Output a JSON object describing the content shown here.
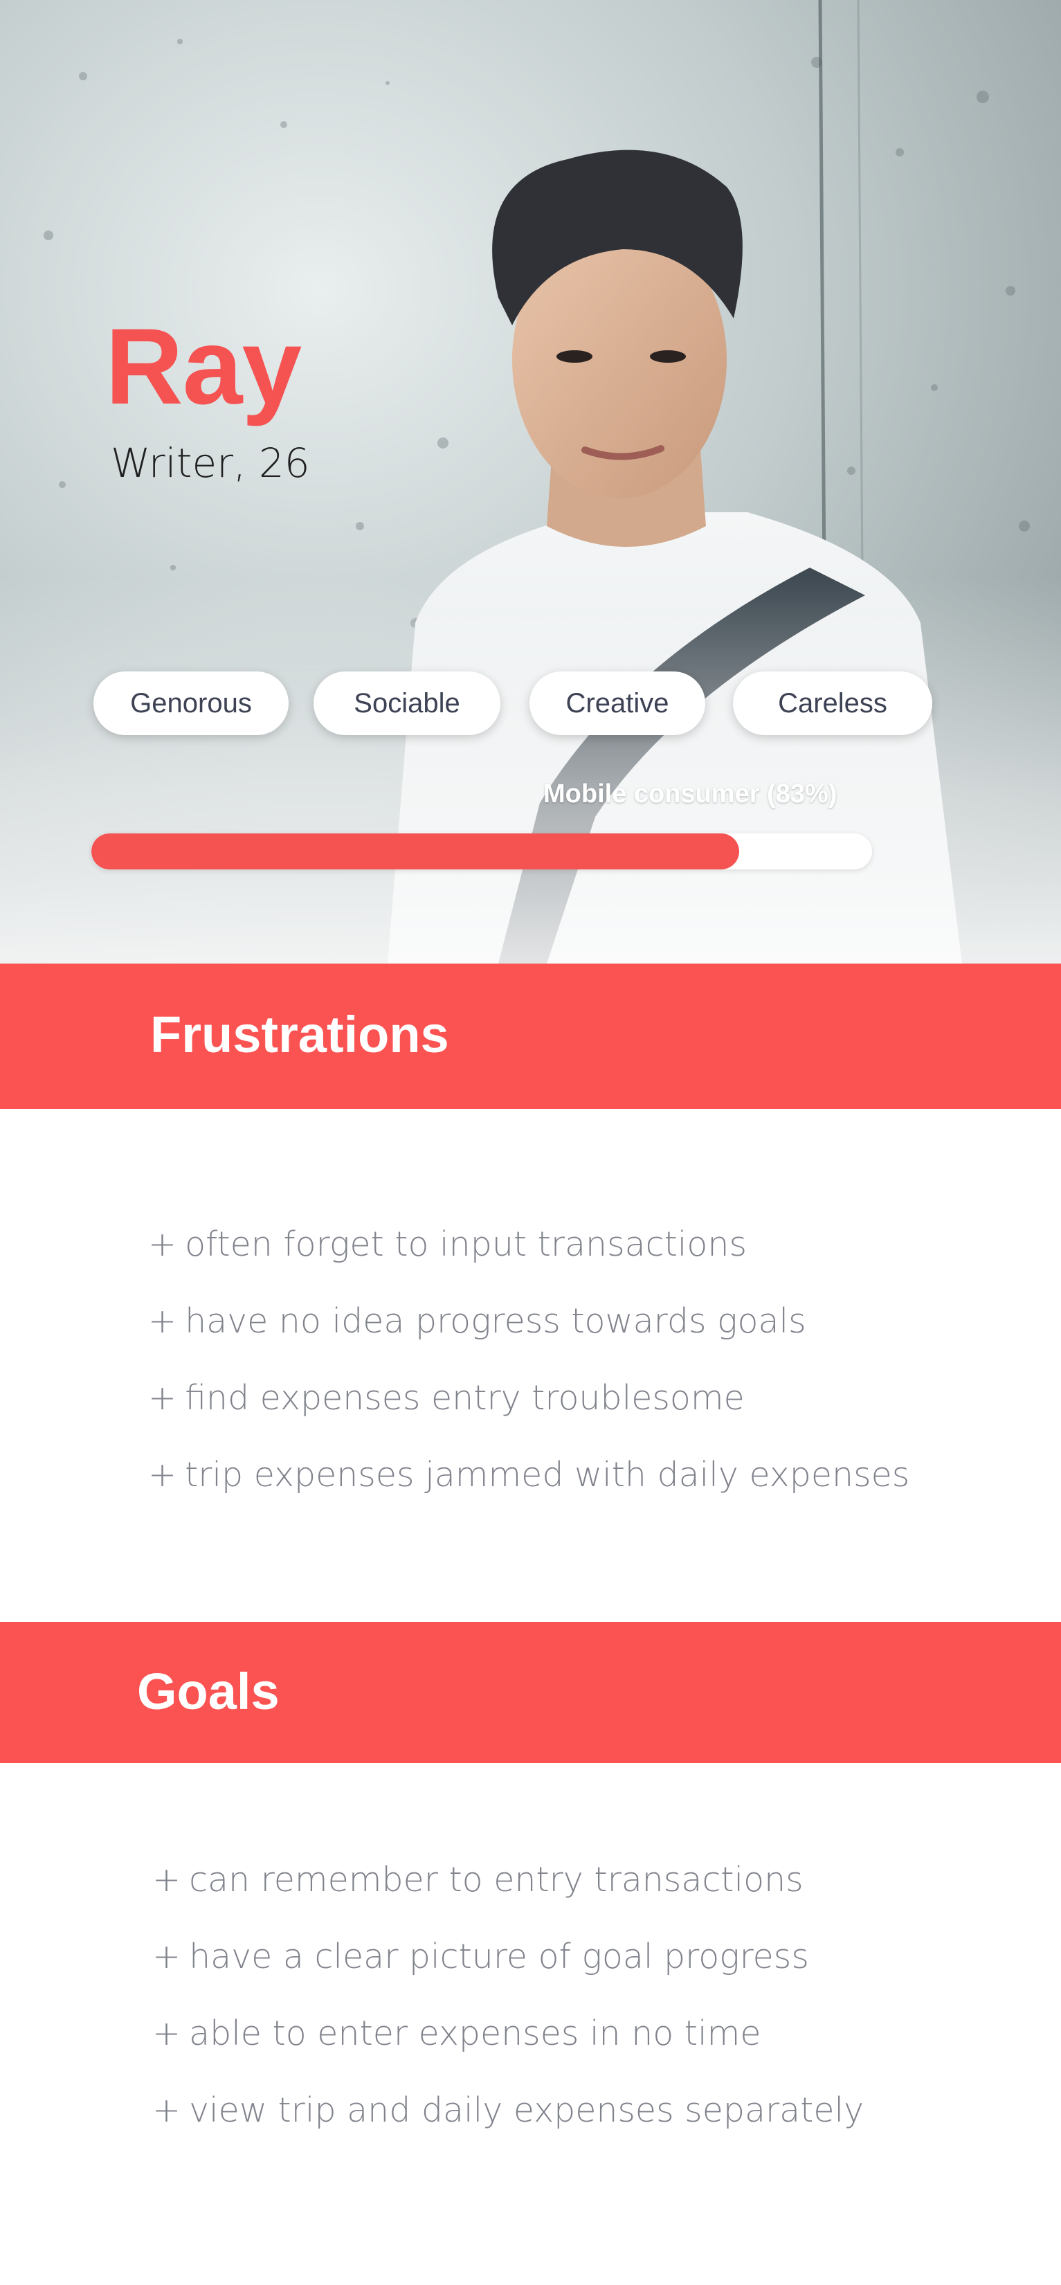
{
  "persona": {
    "name": "Ray",
    "role": "Writer, 26"
  },
  "traits": [
    "Genorous",
    "Sociable",
    "Creative",
    "Careless"
  ],
  "progress": {
    "label": "Mobile consumer (83%)",
    "value_percent": 83,
    "color": "#f55352"
  },
  "frustrations": {
    "title": "Frustrations",
    "items": [
      "often forget to input transactions",
      "have no idea progress towards goals",
      "find expenses entry troublesome",
      "trip expenses jammed with daily expenses"
    ]
  },
  "goals": {
    "title": "Goals",
    "items": [
      "can remember to entry transactions",
      "have a clear picture of goal progress",
      "able to enter expenses in no time",
      "view trip and daily expenses separately"
    ]
  },
  "bullet_symbol": "+",
  "colors": {
    "accent": "#fb5252",
    "text_muted": "#80838c",
    "chip_text": "#3d4254"
  }
}
